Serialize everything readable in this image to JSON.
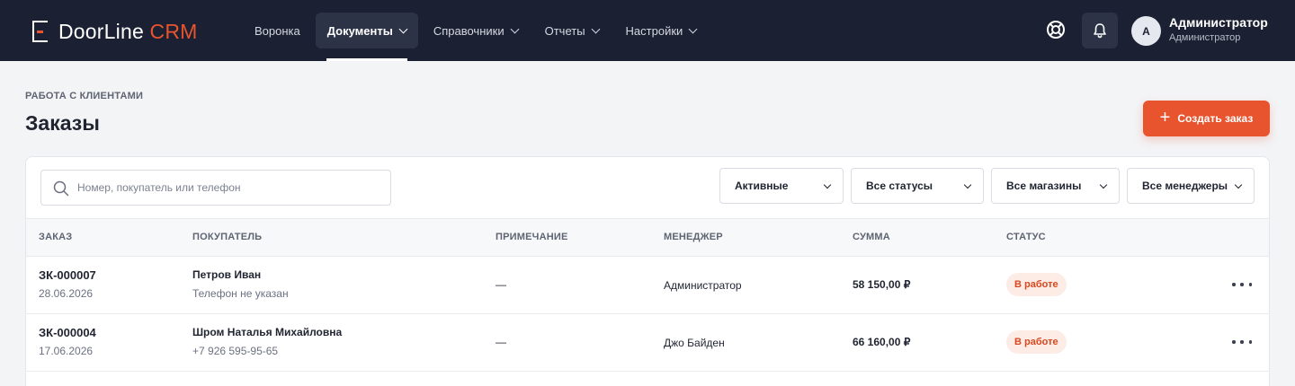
{
  "brand": {
    "name": "DoorLine",
    "accent": "CRM",
    "accent_color": "#e8542e"
  },
  "nav": {
    "items": [
      {
        "label": "Воронка",
        "active": false,
        "dropdown": false
      },
      {
        "label": "Документы",
        "active": true,
        "dropdown": true
      },
      {
        "label": "Справочники",
        "active": false,
        "dropdown": true
      },
      {
        "label": "Отчеты",
        "active": false,
        "dropdown": true
      },
      {
        "label": "Настройки",
        "active": false,
        "dropdown": true
      }
    ]
  },
  "header_icons": {
    "help": "lifebuoy-icon",
    "notifications": "bell-icon"
  },
  "user": {
    "initial": "A",
    "name": "Администратор",
    "role": "Администратор"
  },
  "page": {
    "section": "РАБОТА С КЛИЕНТАМИ",
    "title": "Заказы",
    "create_button": "Создать заказ"
  },
  "filters": {
    "search_placeholder": "Номер, покупатель или телефон",
    "search_value": "",
    "selects": [
      "Активные",
      "Все статусы",
      "Все магазины",
      "Все менеджеры"
    ]
  },
  "table": {
    "columns": [
      "ЗАКАЗ",
      "ПОКУПАТЕЛЬ",
      "ПРИМЕЧАНИЕ",
      "МЕНЕДЖЕР",
      "СУММА",
      "СТАТУС"
    ],
    "rows": [
      {
        "id": "ЗК-000007",
        "date": "28.06.2026",
        "buyer": "Петров Иван",
        "phone": "Телефон не указан",
        "note": "—",
        "manager": "Администратор",
        "sum": "58 150,00 ₽",
        "status": "В работе"
      },
      {
        "id": "ЗК-000004",
        "date": "17.06.2026",
        "buyer": "Шром Наталья Михайловна",
        "phone": "+7 926 595-95-65",
        "note": "—",
        "manager": "Джо Байден",
        "sum": "66 160,00 ₽",
        "status": "В работе"
      }
    ]
  },
  "colors": {
    "topbar": "#1b2032",
    "accent": "#e8542e",
    "badge_bg": "#fdece6",
    "badge_text": "#d9481f"
  }
}
